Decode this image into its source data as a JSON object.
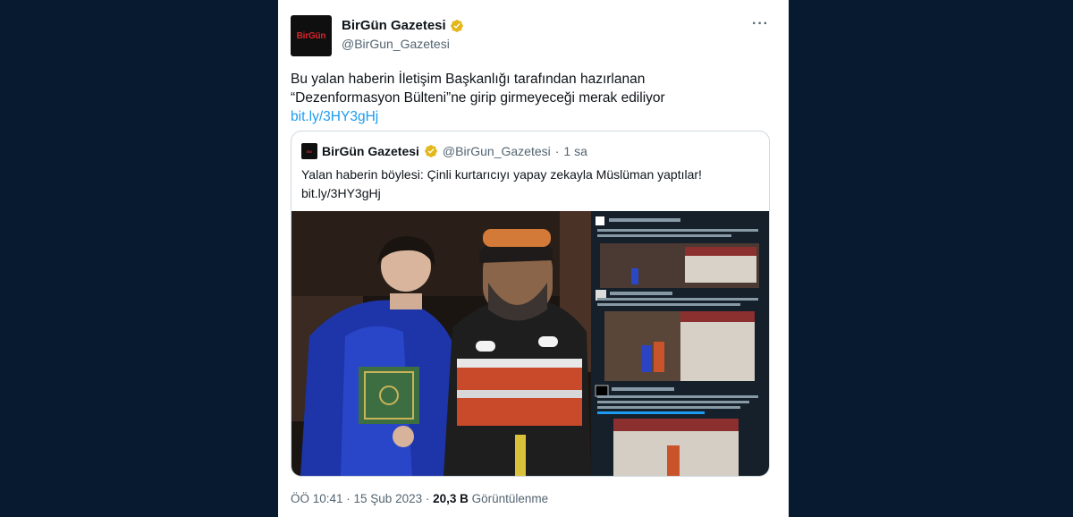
{
  "account": {
    "display_name": "BirGün Gazetesi",
    "handle": "@BirGun_Gazetesi",
    "avatar_text": "BirGün"
  },
  "more_label": "···",
  "tweet": {
    "line1": "Bu yalan haberin İletişim Başkanlığı tarafından hazırlanan",
    "line2": "“Dezenformasyon Bülteni”ne girip girmeyeceği merak ediliyor",
    "link": "bit.ly/3HY3gHj"
  },
  "quote": {
    "display_name": "BirGün Gazetesi",
    "handle": "@BirGun_Gazetesi",
    "separator": "·",
    "time": "1 sa",
    "text": "Yalan haberin böylesi: Çinli kurtarıcıyı yapay zekayla Müslüman yaptılar!",
    "link": "bit.ly/3HY3gHj"
  },
  "footer": {
    "datetime": "ÖÖ 10:41 · 15 Şub 2023 · ",
    "views_count": "20,3 B",
    "views_label": " Görüntülenme"
  },
  "colors": {
    "background": "#081a30",
    "link": "#1d9bf0",
    "verified": "#e2b719",
    "brand_red": "#d7262d"
  },
  "icons": [
    "verified-badge-icon",
    "more-options-icon"
  ]
}
